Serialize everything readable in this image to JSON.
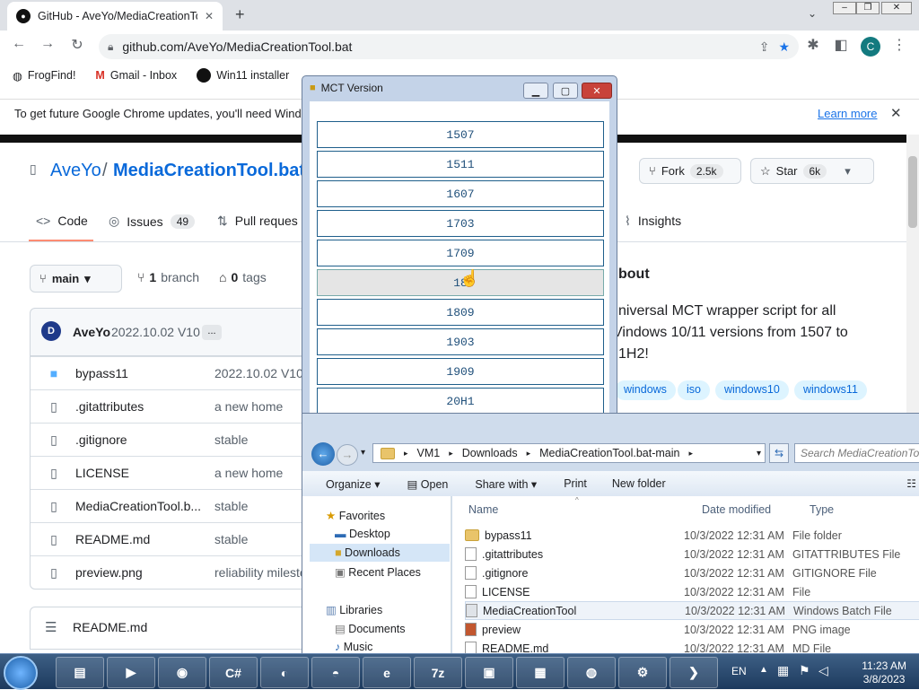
{
  "browser": {
    "tab_title": "GitHub - AveYo/MediaCreationTool.bat",
    "url": "github.com/AveYo/MediaCreationTool.bat",
    "profile_initial": "C",
    "bookmarks": [
      "FrogFind!",
      "Gmail - Inbox",
      "Win11 installer"
    ],
    "infobar_text": "To get future Google Chrome updates, you'll need Wind",
    "infobar_link": "Learn more"
  },
  "github": {
    "owner": "AveYo",
    "separator": "/",
    "repo": "MediaCreationTool.bat",
    "fork_label": "Fork",
    "fork_count": "2.5k",
    "star_label": "Star",
    "star_count": "6k",
    "tabs": [
      {
        "label": "Code"
      },
      {
        "label": "Issues",
        "count": "49"
      },
      {
        "label": "Pull reques"
      },
      {
        "label": "Insights"
      }
    ],
    "branch_label": "main",
    "branches_count": "1",
    "branches_label": "branch",
    "tags_count": "0",
    "tags_label": "tags",
    "commit_author": "AveYo",
    "commit_message": "2022.10.02 V10",
    "commit_ellipsis": "...",
    "avatar_initial": "D",
    "files": [
      {
        "name": "bypass11",
        "message": "2022.10.02 V10",
        "kind": "folder"
      },
      {
        "name": ".gitattributes",
        "message": "a new home",
        "kind": "file"
      },
      {
        "name": ".gitignore",
        "message": "stable",
        "kind": "file"
      },
      {
        "name": "LICENSE",
        "message": "a new home",
        "kind": "file"
      },
      {
        "name": "MediaCreationTool.b...",
        "message": "stable",
        "kind": "file"
      },
      {
        "name": "README.md",
        "message": "stable",
        "kind": "file"
      },
      {
        "name": "preview.png",
        "message": "reliability mileste",
        "kind": "file"
      }
    ],
    "readme_label": "README.md",
    "about_title": "bout",
    "about_lines": [
      "niversal MCT wrapper script for all",
      "Vindows 10/11 versions from 1507 to",
      "1H2!"
    ],
    "topics": [
      "windows",
      "iso",
      "windows10",
      "windows11"
    ]
  },
  "mct": {
    "title": "MCT Version",
    "versions": [
      "1507",
      "1511",
      "1607",
      "1703",
      "1709",
      "18",
      "1809",
      "1903",
      "1909",
      "20H1"
    ]
  },
  "explorer": {
    "breadcrumb": [
      "VM1",
      "Downloads",
      "MediaCreationTool.bat-main"
    ],
    "search_placeholder": "Search MediaCreationTo",
    "commands": [
      "Organize",
      "Open",
      "Share with",
      "Print",
      "New folder"
    ],
    "nav": {
      "favorites": "Favorites",
      "desktop": "Desktop",
      "downloads": "Downloads",
      "recent": "Recent Places",
      "libraries": "Libraries",
      "documents": "Documents",
      "music": "Music"
    },
    "columns": [
      "Name",
      "Date modified",
      "Type"
    ],
    "rows": [
      {
        "name": "bypass11",
        "date": "10/3/2022 12:31 AM",
        "type": "File folder",
        "icon": "folder"
      },
      {
        "name": ".gitattributes",
        "date": "10/3/2022 12:31 AM",
        "type": "GITATTRIBUTES File",
        "icon": "file"
      },
      {
        "name": ".gitignore",
        "date": "10/3/2022 12:31 AM",
        "type": "GITIGNORE File",
        "icon": "file"
      },
      {
        "name": "LICENSE",
        "date": "10/3/2022 12:31 AM",
        "type": "File",
        "icon": "file"
      },
      {
        "name": "MediaCreationTool",
        "date": "10/3/2022 12:31 AM",
        "type": "Windows Batch File",
        "icon": "batch"
      },
      {
        "name": "preview",
        "date": "10/3/2022 12:31 AM",
        "type": "PNG image",
        "icon": "image"
      },
      {
        "name": "README.md",
        "date": "10/3/2022 12:31 AM",
        "type": "MD File",
        "icon": "file"
      }
    ]
  },
  "taskbar": {
    "language": "EN",
    "time": "11:23 AM",
    "date": "3/8/2023",
    "apps": [
      "explorer",
      "media-player",
      "chrome",
      "csharp",
      "firefox",
      "mask",
      "internet-explorer",
      "7z",
      "vm",
      "control-panel",
      "network",
      "tools",
      "powershell"
    ],
    "app_text": {
      "csharp": "C#",
      "7z": "7z"
    }
  }
}
